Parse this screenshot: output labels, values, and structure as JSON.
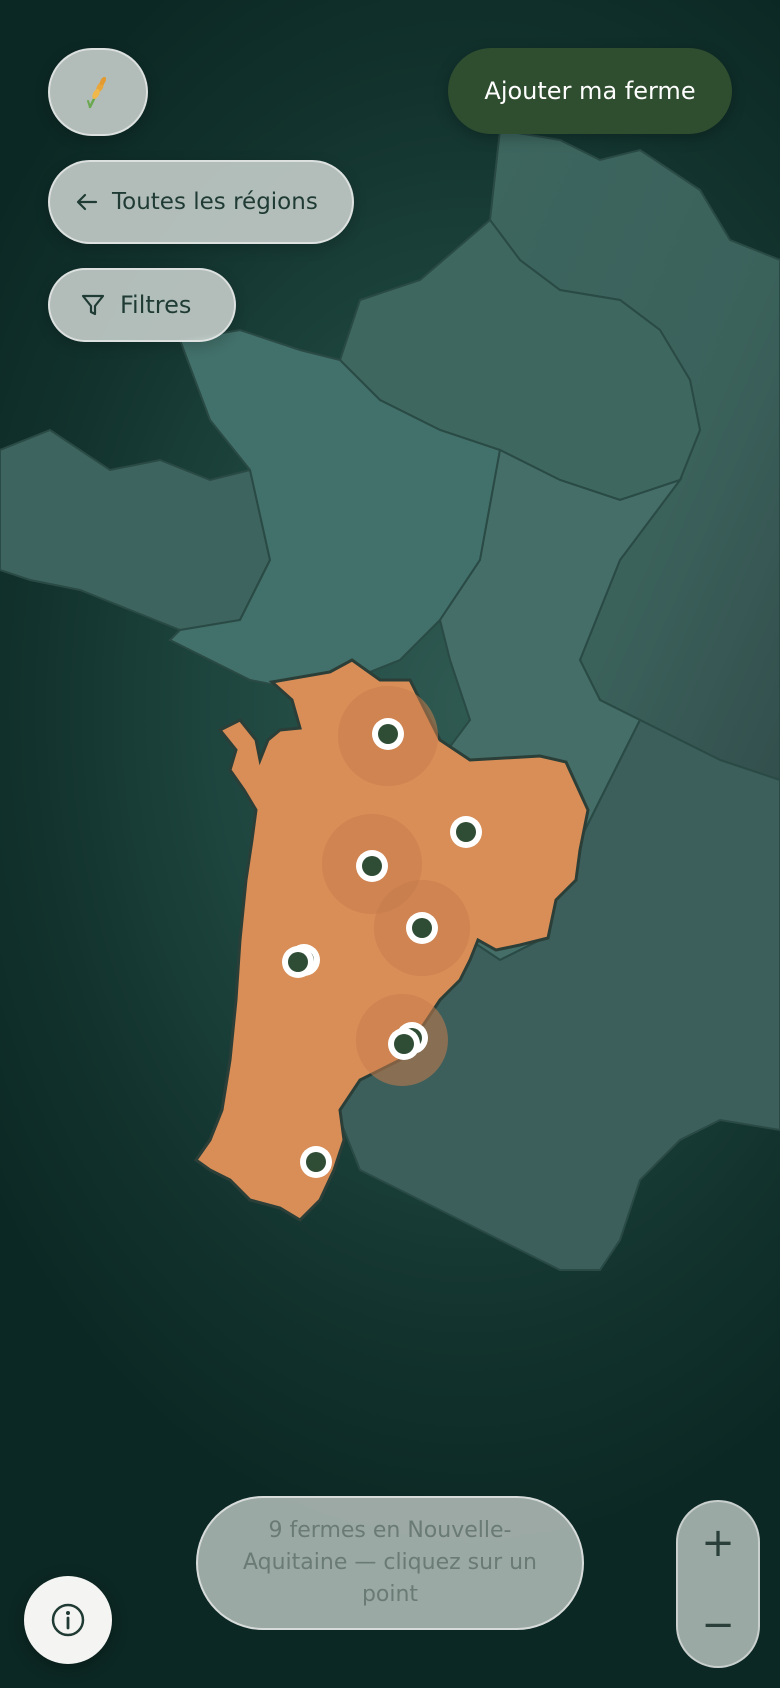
{
  "header": {
    "logo_icon": "wheat-icon",
    "add_farm_label": "Ajouter ma ferme"
  },
  "nav": {
    "back_label": "Toutes les régions",
    "back_icon": "arrow-left-icon",
    "filters_label": "Filtres",
    "filters_icon": "funnel-icon"
  },
  "status": {
    "text": "9 fermes en Nouvelle-Aquitaine — cliquez sur un point"
  },
  "controls": {
    "info_icon": "info-icon",
    "zoom_in_label": "+",
    "zoom_out_label": "−"
  },
  "map": {
    "highlighted_region_color": "#d98e58",
    "other_region_color": "#3f6660",
    "marker_color": "#2f4d34",
    "marker_count": 9
  },
  "colors": {
    "accent_dark_green": "#2f4d2f",
    "glass": "#c4cdca"
  }
}
